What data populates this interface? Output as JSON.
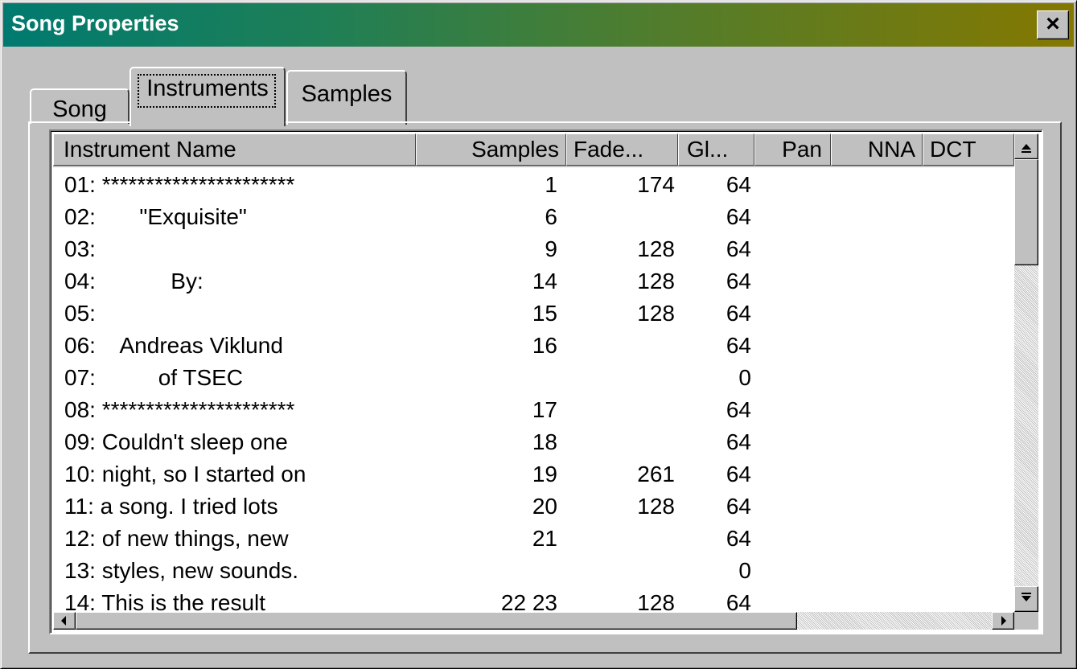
{
  "window": {
    "title": "Song Properties",
    "close_label": "×"
  },
  "tabs": [
    {
      "label": "Song"
    },
    {
      "label": "Instruments"
    },
    {
      "label": "Samples"
    }
  ],
  "columns": [
    "Instrument Name",
    "Samples",
    "Fade...",
    "Gl...",
    "Pan",
    "NNA",
    "DCT"
  ],
  "rows": [
    {
      "name": "01: **********************",
      "samples": "1",
      "fade": "174",
      "gl": "64"
    },
    {
      "name": "02:       \"Exquisite\"",
      "samples": "6",
      "fade": "",
      "gl": "64"
    },
    {
      "name": "03:",
      "samples": "9",
      "fade": "128",
      "gl": "64"
    },
    {
      "name": "04:            By:",
      "samples": "14",
      "fade": "128",
      "gl": "64"
    },
    {
      "name": "05:",
      "samples": "15",
      "fade": "128",
      "gl": "64"
    },
    {
      "name": "06:    Andreas Viklund",
      "samples": "16",
      "fade": "",
      "gl": "64"
    },
    {
      "name": "07:          of TSEC",
      "samples": "",
      "fade": "",
      "gl": "0"
    },
    {
      "name": "08: **********************",
      "samples": "17",
      "fade": "",
      "gl": "64"
    },
    {
      "name": "09: Couldn't sleep one",
      "samples": "18",
      "fade": "",
      "gl": "64"
    },
    {
      "name": "10: night, so I started on",
      "samples": "19",
      "fade": "261",
      "gl": "64"
    },
    {
      "name": "11: a song. I tried lots",
      "samples": "20",
      "fade": "128",
      "gl": "64"
    },
    {
      "name": "12: of new things, new",
      "samples": "21",
      "fade": "",
      "gl": "64"
    },
    {
      "name": "13: styles, new sounds.",
      "samples": "",
      "fade": "",
      "gl": "0"
    },
    {
      "name": "14: This is the result",
      "samples": "22 23",
      "fade": "128",
      "gl": "64"
    }
  ],
  "scrollbars": {
    "up_icon": "up-arrow-icon",
    "down_icon": "down-arrow-icon",
    "left_icon": "left-arrow-icon",
    "right_icon": "right-arrow-icon"
  }
}
